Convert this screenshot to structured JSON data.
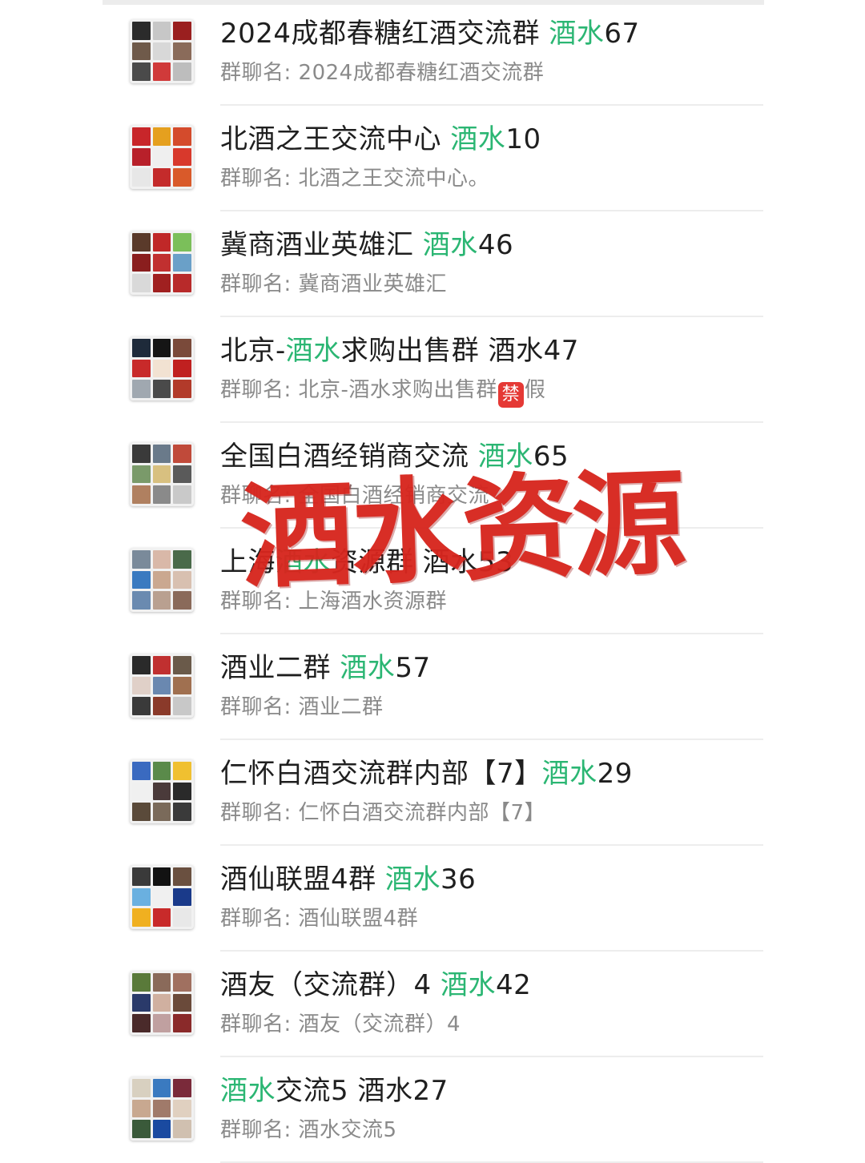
{
  "watermark": "酒水资源",
  "rows": [
    {
      "title_pre": "2024成都春糖红酒交流群 ",
      "title_green": "酒水",
      "title_post": "67",
      "sub_pre": "群聊名: 2024成都春糖红酒交流群",
      "sub_post": "",
      "tiles": [
        "#2b2b2b",
        "#c7c7c7",
        "#9a1f1f",
        "#6f5a4a",
        "#d8d8d8",
        "#8a6b5a",
        "#4a4a4a",
        "#d03a3a",
        "#bdbdbd"
      ]
    },
    {
      "title_pre": "北酒之王交流中心 ",
      "title_green": "酒水",
      "title_post": "10",
      "sub_pre": "群聊名: 北酒之王交流中心。",
      "sub_post": "",
      "tiles": [
        "#c8262a",
        "#e5a01f",
        "#d44b2c",
        "#b8202a",
        "#efefef",
        "#d8392c",
        "#e7e7e7",
        "#c42b2b",
        "#d95a2a"
      ]
    },
    {
      "title_pre": "冀商酒业英雄汇 ",
      "title_green": "酒水",
      "title_post": "46",
      "sub_pre": "群聊名: 冀商酒业英雄汇",
      "sub_post": "",
      "tiles": [
        "#5a3a2a",
        "#c02828",
        "#7bbf5a",
        "#8a1e1e",
        "#c13030",
        "#6aa0c8",
        "#d9d9d9",
        "#a02020",
        "#b82a2a"
      ]
    },
    {
      "title_pre": "北京-",
      "title_green": "酒水",
      "title_post": "求购出售群 酒水47",
      "sub_pre": "群聊名: 北京-酒水求购出售群",
      "sub_post": "假",
      "ban": "禁",
      "tiles": [
        "#1e2a3a",
        "#151515",
        "#7a4a3a",
        "#c82a2a",
        "#f2e2d2",
        "#c02020",
        "#a0a8b0",
        "#4a4a4a",
        "#b23a2a"
      ]
    },
    {
      "title_pre": "全国白酒经销商交流 ",
      "title_green": "酒水",
      "title_post": "65",
      "sub_pre": "群聊名: 全国白酒经销商交流",
      "sub_post": "",
      "tiles": [
        "#3a3a3a",
        "#6a7a8a",
        "#c04a3a",
        "#7a9a6a",
        "#d8c080",
        "#5a5a5a",
        "#b08060",
        "#8a8a8a",
        "#c9c9c9"
      ]
    },
    {
      "title_pre": "上海",
      "title_green": "酒水",
      "title_post": "资源群 酒水53",
      "sub_pre": "群聊名: 上海酒水资源群",
      "sub_post": "",
      "tiles": [
        "#7a8a9a",
        "#d9b8a8",
        "#4a6a4a",
        "#3a7ac0",
        "#caa890",
        "#d8c0b0",
        "#6a8ab0",
        "#b9a090",
        "#8a6a5a"
      ]
    },
    {
      "title_pre": "酒业二群  ",
      "title_green": "酒水",
      "title_post": "57",
      "sub_pre": "群聊名: 酒业二群",
      "sub_post": "",
      "tiles": [
        "#2a2a2a",
        "#c03030",
        "#6a5a4a",
        "#e0d0c8",
        "#6a88b0",
        "#a07050",
        "#3a3a3a",
        "#8a3a2a",
        "#c8c8c8"
      ]
    },
    {
      "title_pre": "仁怀白酒交流群内部【7】",
      "title_green": "酒水",
      "title_post": "29",
      "sub_pre": "群聊名: 仁怀白酒交流群内部【7】",
      "sub_post": "",
      "tiles": [
        "#3a6ac0",
        "#5a8a4a",
        "#f0c030",
        "#f0f0f0",
        "#4a3a3a",
        "#2a2a2a",
        "#5a4a3a",
        "#7a6a5a",
        "#3a3a3a"
      ]
    },
    {
      "title_pre": "酒仙联盟4群 ",
      "title_green": "酒水",
      "title_post": "36",
      "sub_pre": "群聊名: 酒仙联盟4群",
      "sub_post": "",
      "tiles": [
        "#3a3a3a",
        "#121212",
        "#6a5040",
        "#6ab0e0",
        "#f0f0f0",
        "#1a3a8a",
        "#f0b020",
        "#c82a2a",
        "#e8e8e8"
      ]
    },
    {
      "title_pre": "酒友（交流群）4 ",
      "title_green": "酒水",
      "title_post": "42",
      "sub_pre": "群聊名: 酒友（交流群）4",
      "sub_post": "",
      "tiles": [
        "#5a7a3a",
        "#8a6a5a",
        "#a07060",
        "#2a3a6a",
        "#d0b0a0",
        "#6a4a3a",
        "#4a2a2a",
        "#c0a0a0",
        "#8a2a2a"
      ]
    },
    {
      "title_pre": "",
      "title_green": "酒水",
      "title_post": "交流5 酒水27",
      "sub_pre": "群聊名: 酒水交流5",
      "sub_post": "",
      "tiles": [
        "#d8d0c0",
        "#3a7ac0",
        "#7a2a3a",
        "#c8a890",
        "#a07a6a",
        "#e0d0c0",
        "#3a5a3a",
        "#1a4aa0",
        "#d0c0b0"
      ]
    }
  ]
}
